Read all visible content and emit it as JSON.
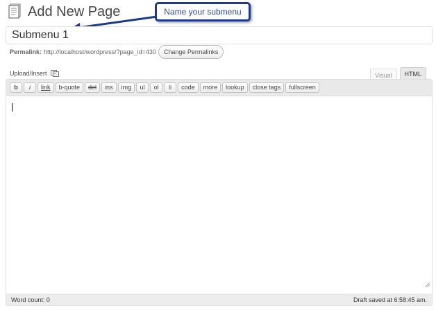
{
  "header": {
    "title": "Add New Page",
    "icon": "page-icon"
  },
  "callout": {
    "text": "Name your submenu",
    "border_color": "#1b3a8c"
  },
  "title_field": {
    "value": "Submenu 1"
  },
  "permalink": {
    "label": "Permalink:",
    "url": "http://localhost/wordpress/?page_id=430",
    "change_button": "Change Permalinks"
  },
  "upload": {
    "label": "Upload/Insert",
    "icon": "media-icon"
  },
  "tabs": {
    "visual": "Visual",
    "html": "HTML",
    "active": "HTML"
  },
  "quicktags": [
    "b",
    "i",
    "link",
    "b-quote",
    "del",
    "ins",
    "img",
    "ul",
    "ol",
    "li",
    "code",
    "more",
    "lookup",
    "close tags",
    "fullscreen"
  ],
  "footer": {
    "word_count": "Word count: 0",
    "draft_saved": "Draft saved at 6:58:45 am."
  }
}
